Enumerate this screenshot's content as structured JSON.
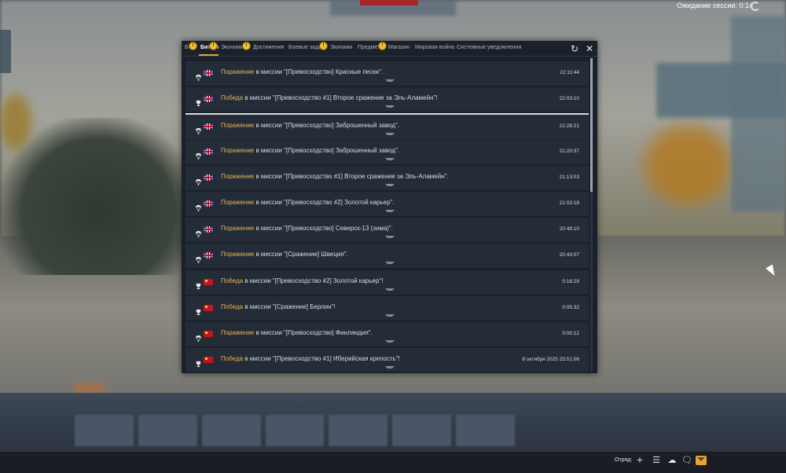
{
  "session": {
    "text": "Ожидание сессии: 0:14"
  },
  "tabs": [
    {
      "label": "Все",
      "badge": "!"
    },
    {
      "label": "Битвы",
      "badge": "!",
      "active": true
    },
    {
      "label": "Экономика",
      "badge": "!"
    },
    {
      "label": "Достижения"
    },
    {
      "label": "Боевые задачи",
      "badge": "!"
    },
    {
      "label": "Экипажи"
    },
    {
      "label": "Предметы",
      "badge": "!"
    },
    {
      "label": "Магазин"
    },
    {
      "label": "Мировая война"
    },
    {
      "label": "Системные уведомления"
    }
  ],
  "controls": {
    "refresh_icon": "refresh-icon",
    "close_icon": "close-icon"
  },
  "colors": {
    "result": "#e6b35a",
    "accent": "#e3a33a",
    "badge": "#f0c030"
  },
  "rows": [
    {
      "icon": "parachute-icon",
      "flag": "uk",
      "result": "Поражение",
      "text": " в миссии \"[Превосходство] Красные пески\".",
      "time": "22:11:44"
    },
    {
      "icon": "trophy-icon",
      "flag": "uk",
      "result": "Победа",
      "text": " в миссии \"[Превосходство #1] Второе сражение за Эль-Аламейн\"!",
      "time": "22:03:10"
    },
    {
      "icon": "parachute-icon",
      "flag": "uk",
      "result": "Поражение",
      "text": " в миссии \"[Превосходство] Заброшенный завод\".",
      "time": "21:28:21"
    },
    {
      "icon": "parachute-icon",
      "flag": "uk",
      "result": "Поражение",
      "text": " в миссии \"[Превосходство] Заброшенный завод\".",
      "time": "21:20:37"
    },
    {
      "icon": "parachute-icon",
      "flag": "uk",
      "result": "Поражение",
      "text": " в миссии \"[Превосходство #1] Второе сражение за Эль-Аламейн\".",
      "time": "21:13:03"
    },
    {
      "icon": "parachute-icon",
      "flag": "uk",
      "result": "Поражение",
      "text": " в миссии \"[Превосходство #2] Золотой карьер\".",
      "time": "21:03:18"
    },
    {
      "icon": "parachute-icon",
      "flag": "uk",
      "result": "Поражение",
      "text": " в миссии \"[Превосходство] Северск-13 (зима)\".",
      "time": "20:49:10"
    },
    {
      "icon": "parachute-icon",
      "flag": "uk",
      "result": "Поражение",
      "text": " в миссии \"[Сражение] Швеция\".",
      "time": "20:43:07"
    },
    {
      "icon": "trophy-icon",
      "flag": "ussr",
      "result": "Победа",
      "text": " в миссии \"[Превосходство #2] Золотой карьер\"!",
      "time": "0:16:29"
    },
    {
      "icon": "trophy-icon",
      "flag": "ussr",
      "result": "Победа",
      "text": " в миссии \"[Сражение] Берлин\"!",
      "time": "0:05:32"
    },
    {
      "icon": "parachute-icon",
      "flag": "ussr",
      "result": "Поражение",
      "text": " в миссии \"[Превосходство] Финляндия\".",
      "time": "0:00:12"
    },
    {
      "icon": "trophy-icon",
      "flag": "ussr",
      "result": "Победа",
      "text": " в миссии \"[Превосходство #1] Иберийская крепость\"!",
      "time": "8 октября 2025 23:51:06"
    }
  ],
  "bottom": {
    "squad_label": "Отряд:"
  }
}
